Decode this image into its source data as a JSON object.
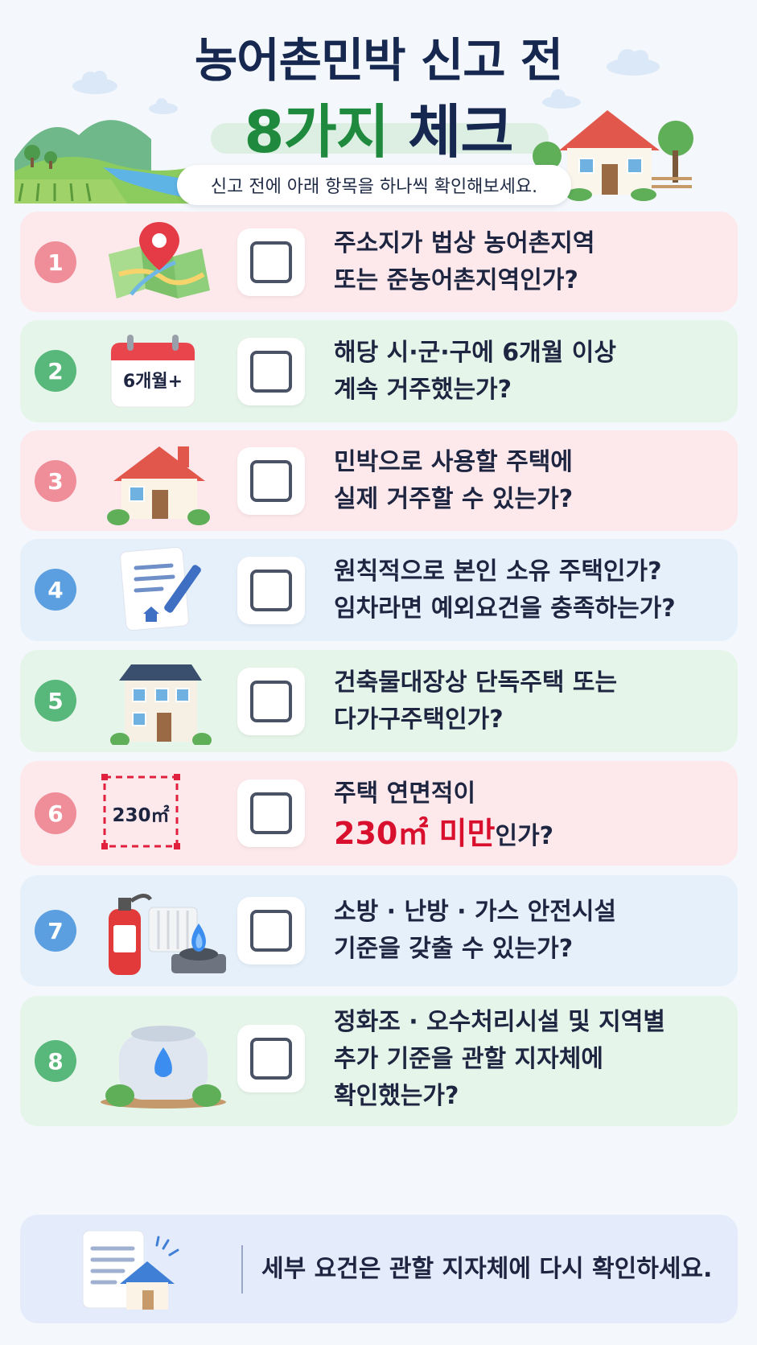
{
  "header": {
    "title_line1": "농어촌민박 신고 전",
    "title_line2_highlight": "8가지",
    "title_line2_rest": "체크",
    "subtitle": "신고 전에 아래 항목을 하나씩 확인해보세요."
  },
  "items": [
    {
      "number": "1",
      "line1": "주소지가 법상 농어촌지역",
      "line2": "또는 준농어촌지역인가?"
    },
    {
      "number": "2",
      "badge": "6개월+",
      "line1": "해당 시·군·구에 6개월 이상",
      "line2": "계속 거주했는가?"
    },
    {
      "number": "3",
      "line1": "민박으로 사용할 주택에",
      "line2": "실제 거주할 수 있는가?"
    },
    {
      "number": "4",
      "line1": "원칙적으로 본인 소유 주택인가?",
      "line2": "임차라면 예외요건을 충족하는가?"
    },
    {
      "number": "5",
      "line1": "건축물대장상 단독주택 또는",
      "line2": "다가구주택인가?"
    },
    {
      "number": "6",
      "badge": "230㎡",
      "line1": "주택 연면적이",
      "line2_highlight": "230㎡ 미만",
      "line2_rest": "인가?"
    },
    {
      "number": "7",
      "line1": "소방 · 난방 · 가스 안전시설",
      "line2": "기준을 갖출 수 있는가?"
    },
    {
      "number": "8",
      "line1": "정화조 · 오수처리시설 및 지역별",
      "line2": "추가 기준을 관할 지자체에",
      "line3": "확인했는가?"
    }
  ],
  "footer": {
    "text": "세부 요건은 관할 지자체에 다시 확인하세요."
  },
  "colors": {
    "navy": "#16284f",
    "green": "#1f8a3e",
    "red_highlight": "#d8102e",
    "card_pink": "#fde9ec",
    "card_mint": "#e6f5ea",
    "card_sky": "#e5f0fb"
  },
  "icons": [
    "map-pin-icon",
    "calendar-icon",
    "house-icon",
    "document-pen-icon",
    "two-story-house-icon",
    "area-measure-icon",
    "safety-equipment-icon",
    "water-tank-icon",
    "document-house-icon"
  ]
}
